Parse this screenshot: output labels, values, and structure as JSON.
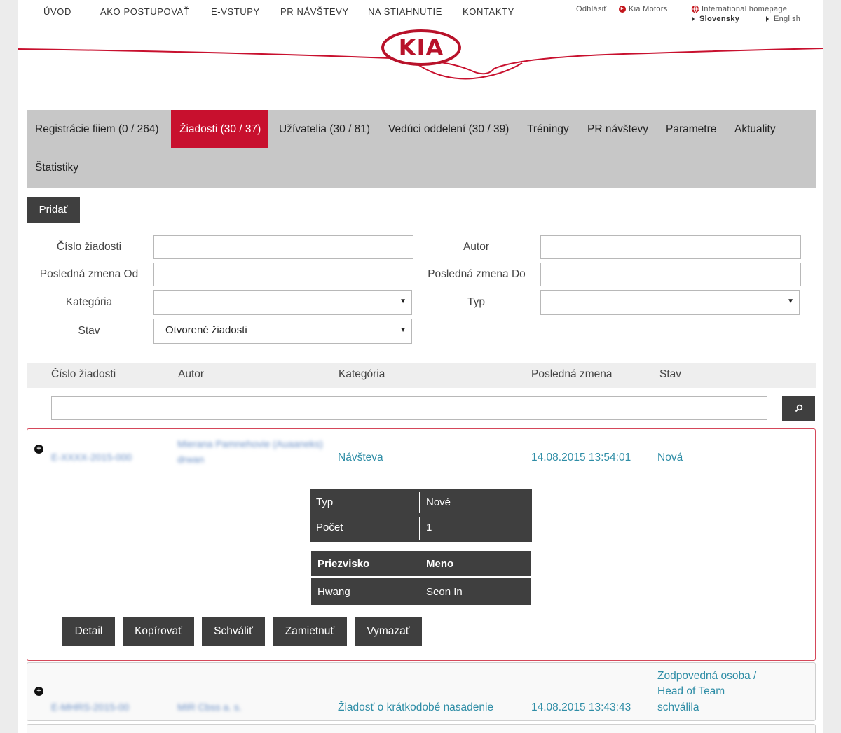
{
  "header": {
    "nav": [
      "ÚVOD",
      "AKO POSTUPOVAŤ",
      "E-VSTUPY",
      "PR NÁVŠTEVY",
      "NA STIAHNUTIE",
      "KONTAKTY"
    ],
    "logout": "Odhlásiť",
    "kia_motors": "Kia Motors",
    "intl_homepage": "International homepage",
    "lang_sk": "Slovensky",
    "lang_en": "English",
    "logo_text": "KIA"
  },
  "tabs": [
    {
      "label": "Registrácie fiiem (0 / 264)",
      "active": false
    },
    {
      "label": "Žiadosti (30 / 37)",
      "active": true
    },
    {
      "label": "Užívatelia (30 / 81)",
      "active": false
    },
    {
      "label": "Vedúci oddelení (30 / 39)",
      "active": false
    },
    {
      "label": "Tréningy",
      "active": false
    },
    {
      "label": "PR návštevy",
      "active": false
    },
    {
      "label": "Parametre",
      "active": false
    },
    {
      "label": "Aktuality",
      "active": false
    },
    {
      "label": "Štatistiky",
      "active": false
    }
  ],
  "add_button": "Pridať",
  "filters": {
    "request_number_label": "Číslo žiadosti",
    "author_label": "Autor",
    "changed_from_label": "Posledná zmena Od",
    "changed_to_label": "Posledná zmena Do",
    "category_label": "Kategória",
    "type_label": "Typ",
    "status_label": "Stav",
    "status_value": "Otvorené žiadosti"
  },
  "table": {
    "headers": [
      "Číslo žiadosti",
      "Autor",
      "Kategória",
      "Posledná zmena",
      "Stav"
    ],
    "search_value": "",
    "rows": [
      {
        "number": "E-XXXX-2015-000",
        "author": "Mierana Pamnehovie (Auaaneks) drwan",
        "category": "Návšteva",
        "changed": "14.08.2015 13:54:01",
        "status": "Nová"
      },
      {
        "number": "E-MHRS-2015-00",
        "author": "MIR Cbss a. s.",
        "category": "Žiadosť o krátkodobé nasadenie",
        "changed": "14.08.2015 13:43:43",
        "status_lines": [
          "Zodpovedná osoba /",
          "Head of Team",
          "schválila"
        ]
      }
    ]
  },
  "detail": {
    "type_label": "Typ",
    "type_value": "Nové",
    "count_label": "Počet",
    "count_value": "1",
    "surname_header": "Priezvisko",
    "name_header": "Meno",
    "surname": "Hwang",
    "name": "Seon In"
  },
  "actions": [
    "Detail",
    "Kopírovať",
    "Schváliť",
    "Zamietnuť",
    "Vymazať"
  ],
  "colors": {
    "accent": "#c8102e",
    "dark": "#3f3f3f",
    "link": "#2e8da6"
  }
}
